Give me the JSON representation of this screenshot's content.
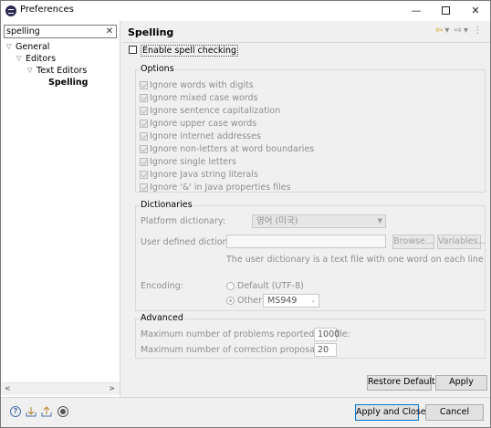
{
  "window": {
    "title": "Preferences"
  },
  "filter": {
    "value": "spelling",
    "clear_glyph": "✕"
  },
  "tree": {
    "items": [
      {
        "label": "General",
        "arrow": "▽"
      },
      {
        "label": "Editors",
        "arrow": "▽"
      },
      {
        "label": "Text Editors",
        "arrow": "▽"
      },
      {
        "label": "Spelling",
        "arrow": ""
      }
    ]
  },
  "page": {
    "title": "Spelling"
  },
  "enable_spell_checking": {
    "label": "Enable spell checking",
    "checked": false
  },
  "options": {
    "title": "Options",
    "items": [
      "Ignore words with digits",
      "Ignore mixed case words",
      "Ignore sentence capitalization",
      "Ignore upper case words",
      "Ignore internet addresses",
      "Ignore non-letters at word boundaries",
      "Ignore single letters",
      "Ignore Java string literals",
      "Ignore '&' in Java properties files"
    ]
  },
  "dictionaries": {
    "title": "Dictionaries",
    "platform_label": "Platform dictionary:",
    "platform_value": "영어 (미국)",
    "user_label": "User defined dictionary:",
    "browse_label": "Browse...",
    "variables_label": "Variables...",
    "hint": "The user dictionary is a text file with one word on each line",
    "encoding_label": "Encoding:",
    "default_label": "Default (UTF-8)",
    "other_label": "Other:",
    "other_value": "MS949"
  },
  "advanced": {
    "title": "Advanced",
    "max_problems_label": "Maximum number of problems reported per file:",
    "max_problems_value": "1000",
    "max_proposals_label": "Maximum number of correction proposals:",
    "max_proposals_value": "20"
  },
  "buttons": {
    "restore_defaults": "Restore Defaults",
    "apply": "Apply",
    "apply_and_close": "Apply and Close",
    "cancel": "Cancel"
  },
  "icons": {
    "help": "?",
    "minimize": "—",
    "close": "✕"
  }
}
